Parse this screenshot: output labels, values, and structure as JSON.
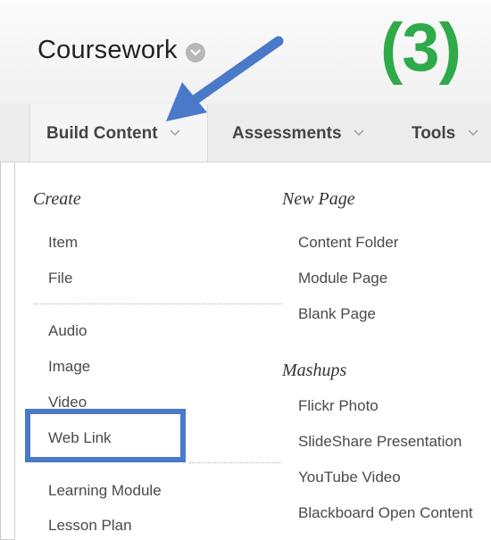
{
  "header": {
    "title": "Coursework",
    "step_label": "(3)"
  },
  "menubar": {
    "tabs": [
      {
        "label": "Build Content"
      },
      {
        "label": "Assessments"
      },
      {
        "label": "Tools"
      }
    ]
  },
  "dropdown": {
    "create": {
      "heading": "Create",
      "items": [
        "Item",
        "File",
        "Audio",
        "Image",
        "Video",
        "Web Link",
        "Learning Module",
        "Lesson Plan"
      ]
    },
    "new_page": {
      "heading": "New Page",
      "items": [
        "Content Folder",
        "Module Page",
        "Blank Page"
      ]
    },
    "mashups": {
      "heading": "Mashups",
      "items": [
        "Flickr Photo",
        "SlideShare Presentation",
        "YouTube Video",
        "Blackboard Open Content"
      ]
    }
  },
  "annotations": {
    "arrow_color": "#4a79c9",
    "highlight_color": "#4a79c9",
    "step_color": "#2eaa4a",
    "highlighted_item": "Web Link"
  },
  "icons": [
    "chevron-down-icon",
    "arrow-annotation-icon"
  ]
}
